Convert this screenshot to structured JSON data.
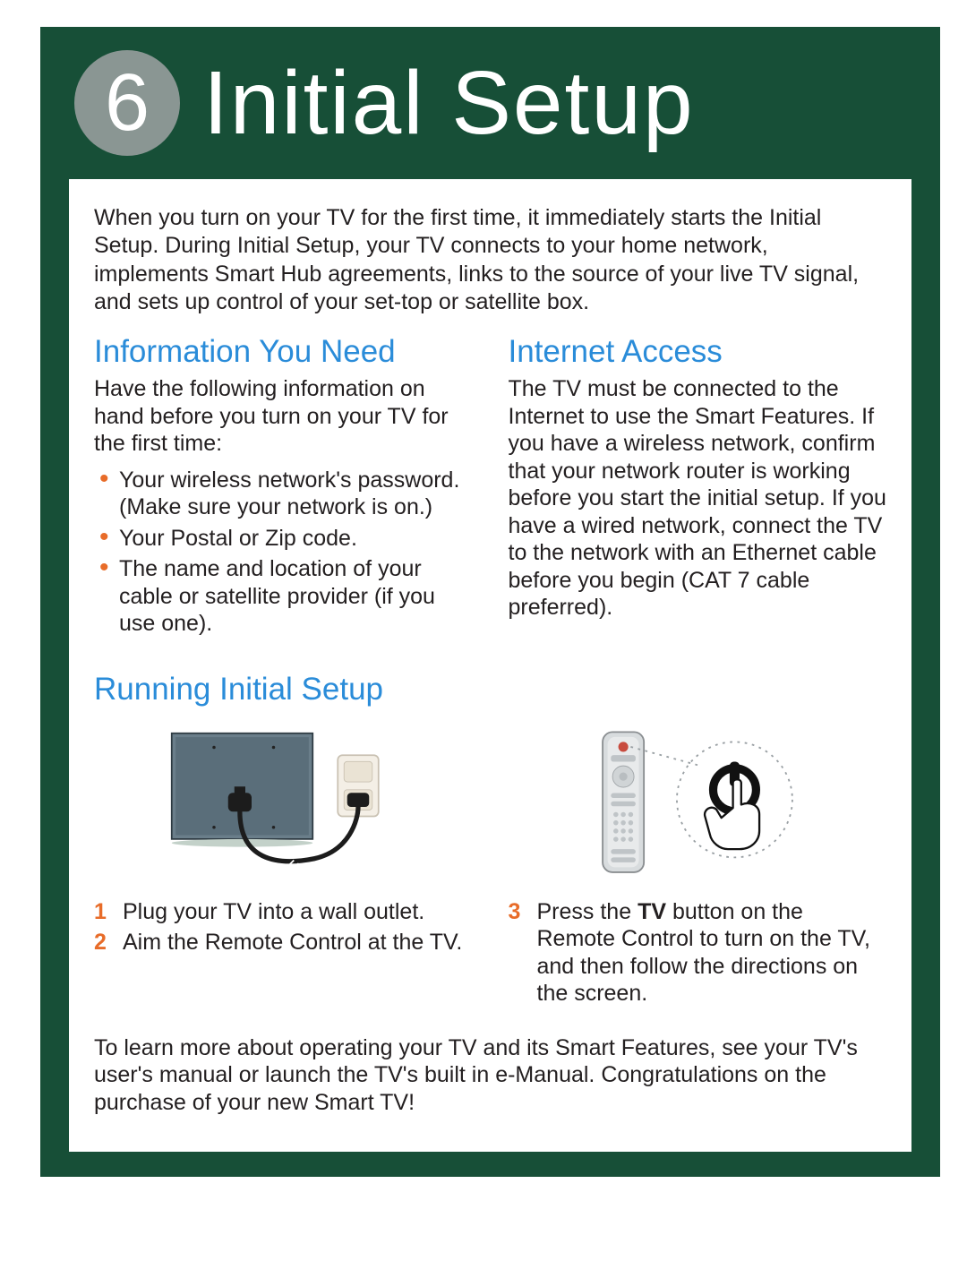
{
  "step_number": "6",
  "page_title": "Initial Setup",
  "intro": "When you turn on your TV for the first time, it immediately starts the Initial Setup. During Initial Setup, your TV connects to your home network, implements Smart Hub agreements, links to the source of your live TV signal, and sets up control of your set-top or satellite box.",
  "info_heading": "Information You Need",
  "info_body": "Have the following information on hand before you turn on your TV for the first time:",
  "info_bullets": [
    "Your wireless network's password. (Make sure your network is on.)",
    "Your Postal or Zip code.",
    "The name and location of your cable or satellite provider (if you use one)."
  ],
  "internet_heading": "Internet Access",
  "internet_body": "The TV must be connected to the Internet to use the Smart Features. If you have a wireless network, confirm that your network router is working before you start the initial setup. If you have a wired network, connect the TV to the network with an Ethernet cable before you begin (CAT 7 cable preferred).",
  "running_heading": "Running Initial Setup",
  "steps_left": [
    {
      "n": "1",
      "text": "Plug your TV into a wall outlet."
    },
    {
      "n": "2",
      "text": "Aim the Remote Control at the TV."
    }
  ],
  "steps_right": [
    {
      "n": "3",
      "text_pre": "Press the ",
      "bold": "TV",
      "text_post": " button on the Remote Control to turn on the TV, and then follow the directions on the screen."
    }
  ],
  "footer": "To learn more about operating your TV and its Smart Features, see your TV's user's manual or launch the TV's built in e-Manual. Congratulations on the purchase of your new Smart TV!"
}
